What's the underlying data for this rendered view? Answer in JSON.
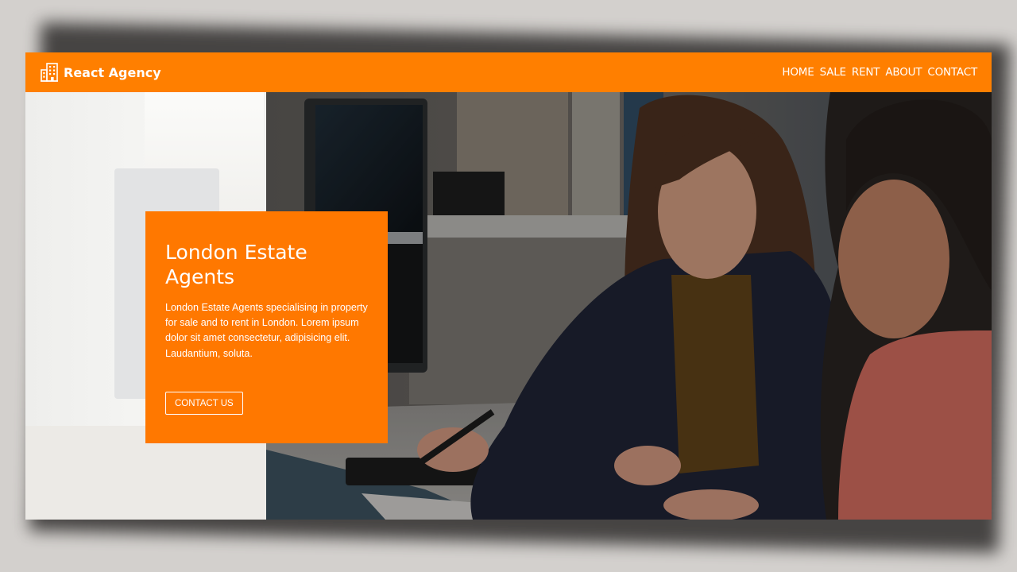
{
  "navbar": {
    "brand": "React Agency",
    "brand_icon": "buildings-icon",
    "background": "#ff7f00",
    "links": [
      "HOME",
      "SALE",
      "RENT",
      "ABOUT",
      "CONTACT"
    ]
  },
  "hero": {
    "title": "London Estate Agents",
    "text": "London Estate Agents specialising in property for sale and to rent in London. Lorem ipsum dolor sit amet consectetur, adipisicing elit. Laudantium, soluta.",
    "cta": "CONTACT US",
    "caption_background": "#ff7800"
  }
}
